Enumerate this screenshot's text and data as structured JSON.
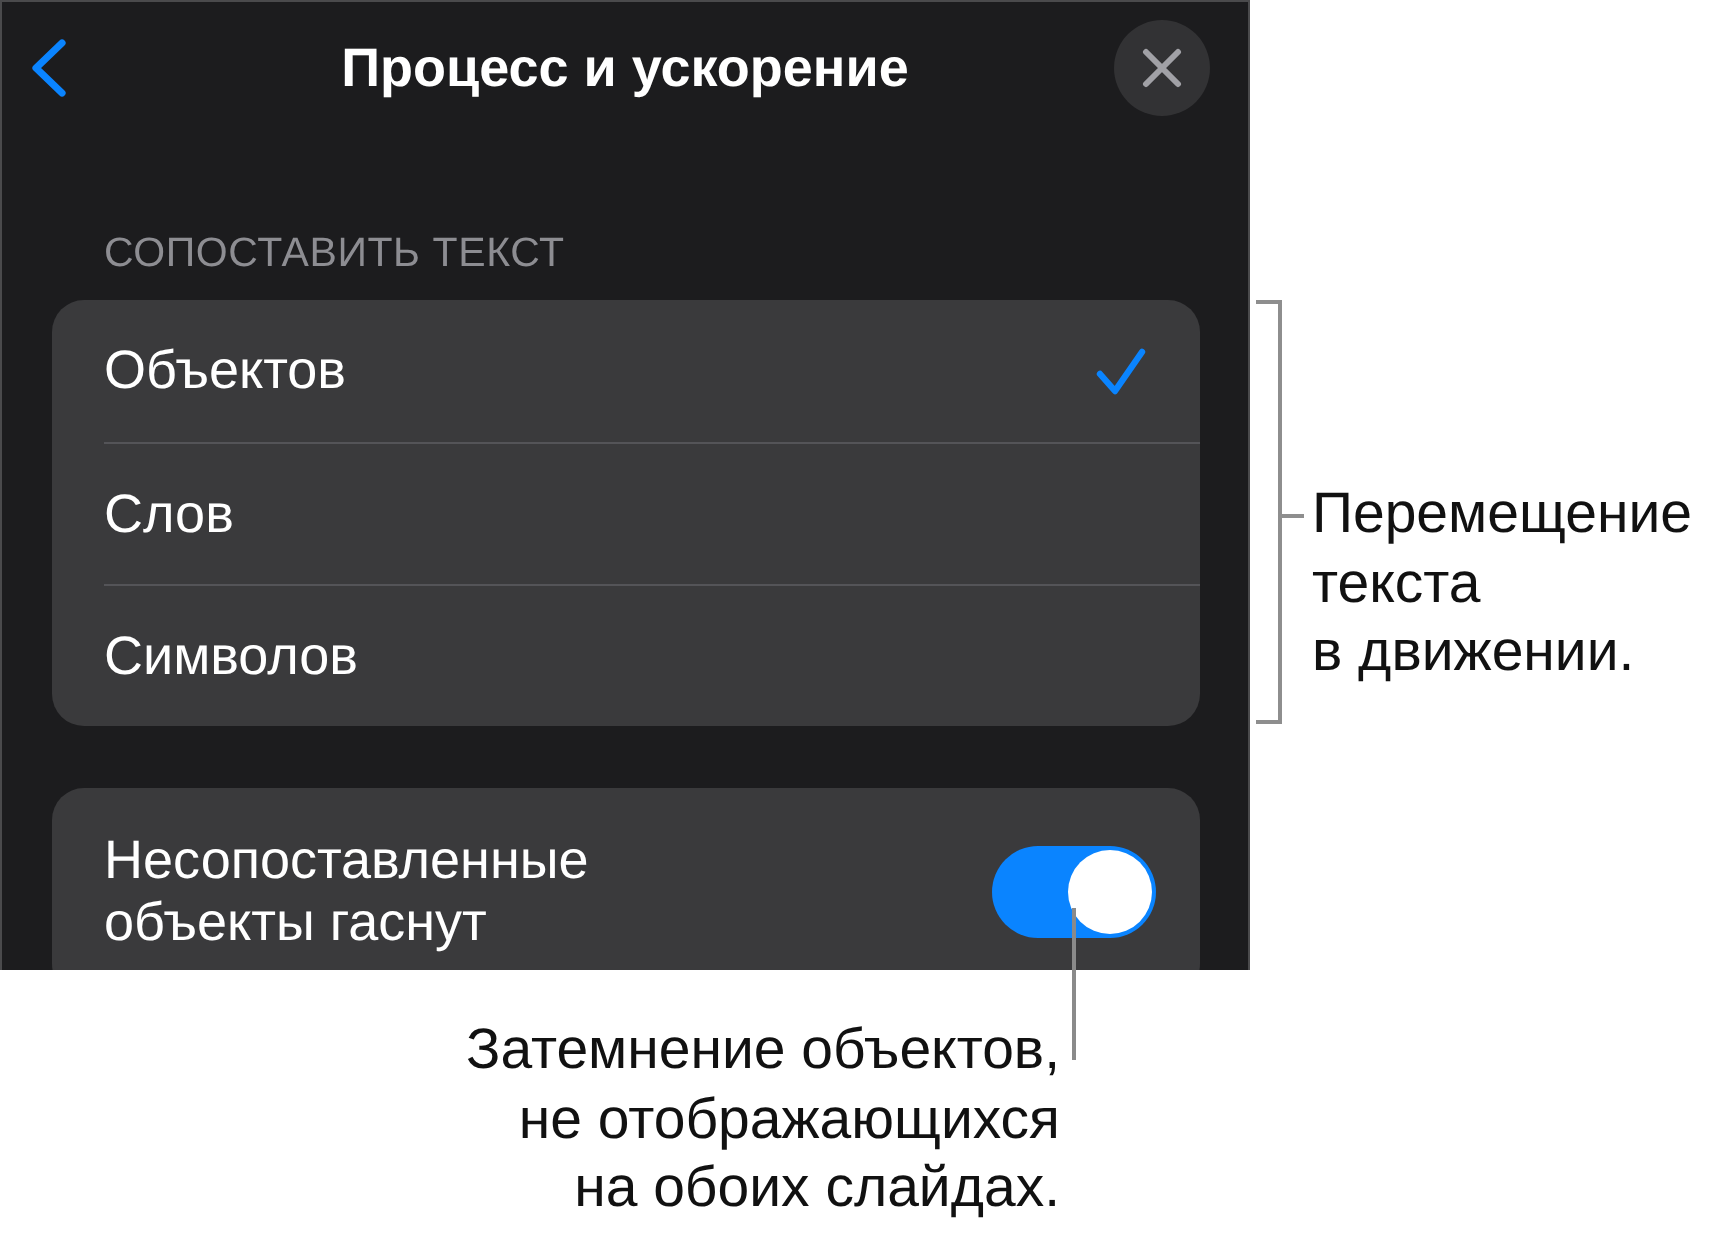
{
  "header": {
    "title": "Процесс и ускорение"
  },
  "match_section": {
    "heading": "СОПОСТАВИТЬ ТЕКСТ",
    "options": [
      {
        "label": "Объектов",
        "selected": true
      },
      {
        "label": "Слов",
        "selected": false
      },
      {
        "label": "Символов",
        "selected": false
      }
    ]
  },
  "fade_setting": {
    "label": "Несопоставленные\nобъекты гаснут",
    "on": true
  },
  "callouts": [
    {
      "kind": "bracket",
      "text": "Перемещение\nтекста\nв движении."
    },
    {
      "kind": "leader",
      "text": "Затемнение объектов,\nне отображающихся\nна обоих слайдах."
    }
  ]
}
